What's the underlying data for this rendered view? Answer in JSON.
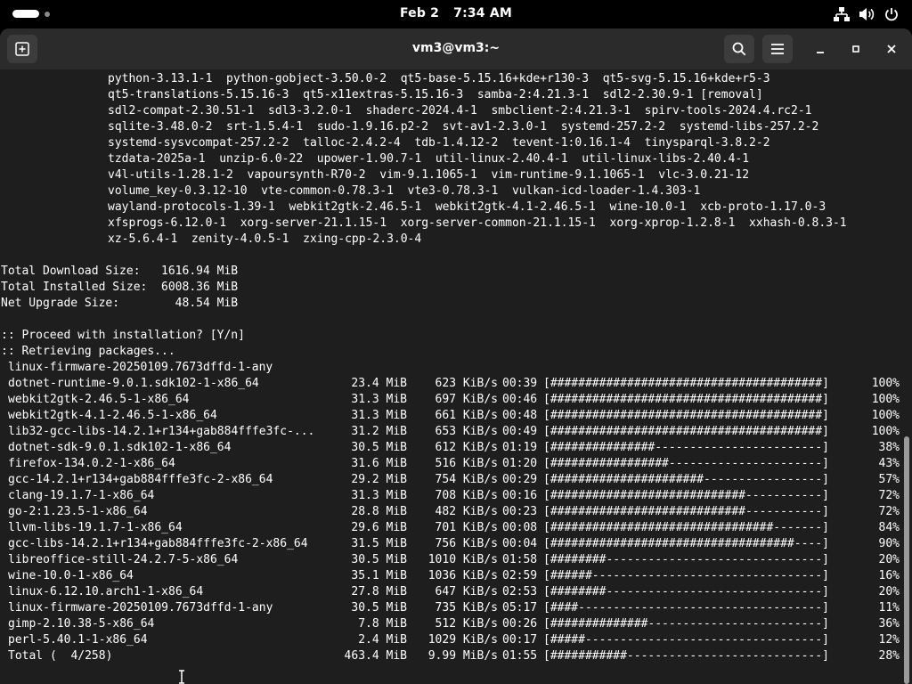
{
  "topbar": {
    "date": "Feb 2",
    "time": "7:34 AM",
    "icons": [
      "network-icon",
      "volume-icon",
      "power-icon"
    ]
  },
  "window": {
    "title": "vm3@vm3:~",
    "buttons": [
      "new-tab-icon",
      "search-icon",
      "menu-icon",
      "minimize-icon",
      "maximize-icon",
      "close-icon"
    ]
  },
  "terminal": {
    "package_lines": [
      "python-3.13.1-1  python-gobject-3.50.0-2  qt5-base-5.15.16+kde+r130-3  qt5-svg-5.15.16+kde+r5-3",
      "qt5-translations-5.15.16-3  qt5-x11extras-5.15.16-3  samba-2:4.21.3-1  sdl2-2.30.9-1 [removal]",
      "sdl2-compat-2.30.51-1  sdl3-3.2.0-1  shaderc-2024.4-1  smbclient-2:4.21.3-1  spirv-tools-2024.4.rc2-1",
      "sqlite-3.48.0-2  srt-1.5.4-1  sudo-1.9.16.p2-2  svt-av1-2.3.0-1  systemd-257.2-2  systemd-libs-257.2-2",
      "systemd-sysvcompat-257.2-2  talloc-2.4.2-4  tdb-1.4.12-2  tevent-1:0.16.1-4  tinysparql-3.8.2-2",
      "tzdata-2025a-1  unzip-6.0-22  upower-1.90.7-1  util-linux-2.40.4-1  util-linux-libs-2.40.4-1",
      "v4l-utils-1.28.1-2  vapoursynth-R70-2  vim-9.1.1065-1  vim-runtime-9.1.1065-1  vlc-3.0.21-12",
      "volume_key-0.3.12-10  vte-common-0.78.3-1  vte3-0.78.3-1  vulkan-icd-loader-1.4.303-1",
      "wayland-protocols-1.39-1  webkit2gtk-2.46.5-1  webkit2gtk-4.1-2.46.5-1  wine-10.0-1  xcb-proto-1.17.0-3",
      "xfsprogs-6.12.0-1  xorg-server-21.1.15-1  xorg-server-common-21.1.15-1  xorg-xprop-1.2.8-1  xxhash-0.8.3-1",
      "xz-5.6.4-1  zenity-4.0.5-1  zxing-cpp-2.3.0-4"
    ],
    "summary": [
      "Total Download Size:   1616.94 MiB",
      "Total Installed Size:  6008.36 MiB",
      "Net Upgrade Size:        48.54 MiB"
    ],
    "prompt": ":: Proceed with installation? [Y/n]",
    "retrieving": ":: Retrieving packages...",
    "first_pkg": " linux-firmware-20250109.7673dffd-1-any",
    "downloads": [
      {
        "name": "dotnet-runtime-9.0.1.sdk102-1-x86_64",
        "size": "23.4 MiB",
        "rate": "623 KiB/s",
        "time": "00:39",
        "bar": "[#######################################]",
        "pct": "100%"
      },
      {
        "name": "webkit2gtk-2.46.5-1-x86_64",
        "size": "31.3 MiB",
        "rate": "697 KiB/s",
        "time": "00:46",
        "bar": "[#######################################]",
        "pct": "100%"
      },
      {
        "name": "webkit2gtk-4.1-2.46.5-1-x86_64",
        "size": "31.3 MiB",
        "rate": "661 KiB/s",
        "time": "00:48",
        "bar": "[#######################################]",
        "pct": "100%"
      },
      {
        "name": "lib32-gcc-libs-14.2.1+r134+gab884fffe3fc-...",
        "size": "31.2 MiB",
        "rate": "653 KiB/s",
        "time": "00:49",
        "bar": "[#######################################]",
        "pct": "100%"
      },
      {
        "name": "dotnet-sdk-9.0.1.sdk102-1-x86_64",
        "size": "30.5 MiB",
        "rate": "612 KiB/s",
        "time": "01:19",
        "bar": "[###############------------------------]",
        "pct": "38%"
      },
      {
        "name": "firefox-134.0.2-1-x86_64",
        "size": "31.6 MiB",
        "rate": "516 KiB/s",
        "time": "01:20",
        "bar": "[#################----------------------]",
        "pct": "43%"
      },
      {
        "name": "gcc-14.2.1+r134+gab884fffe3fc-2-x86_64",
        "size": "29.2 MiB",
        "rate": "754 KiB/s",
        "time": "00:29",
        "bar": "[######################-----------------]",
        "pct": "57%"
      },
      {
        "name": "clang-19.1.7-1-x86_64",
        "size": "31.3 MiB",
        "rate": "708 KiB/s",
        "time": "00:16",
        "bar": "[############################-----------]",
        "pct": "72%"
      },
      {
        "name": "go-2:1.23.5-1-x86_64",
        "size": "28.8 MiB",
        "rate": "482 KiB/s",
        "time": "00:23",
        "bar": "[############################-----------]",
        "pct": "72%"
      },
      {
        "name": "llvm-libs-19.1.7-1-x86_64",
        "size": "29.6 MiB",
        "rate": "701 KiB/s",
        "time": "00:08",
        "bar": "[################################-------]",
        "pct": "84%"
      },
      {
        "name": "gcc-libs-14.2.1+r134+gab884fffe3fc-2-x86_64",
        "size": "31.5 MiB",
        "rate": "756 KiB/s",
        "time": "00:04",
        "bar": "[###################################----]",
        "pct": "90%"
      },
      {
        "name": "libreoffice-still-24.2.7-5-x86_64",
        "size": "30.5 MiB",
        "rate": "1010 KiB/s",
        "time": "01:58",
        "bar": "[########-------------------------------]",
        "pct": "20%"
      },
      {
        "name": "wine-10.0-1-x86_64",
        "size": "35.1 MiB",
        "rate": "1036 KiB/s",
        "time": "02:59",
        "bar": "[######---------------------------------]",
        "pct": "16%"
      },
      {
        "name": "linux-6.12.10.arch1-1-x86_64",
        "size": "27.8 MiB",
        "rate": "647 KiB/s",
        "time": "02:53",
        "bar": "[########-------------------------------]",
        "pct": "20%"
      },
      {
        "name": "linux-firmware-20250109.7673dffd-1-any",
        "size": "30.5 MiB",
        "rate": "735 KiB/s",
        "time": "05:17",
        "bar": "[####-----------------------------------]",
        "pct": "11%"
      },
      {
        "name": "gimp-2.10.38-5-x86_64",
        "size": "7.8 MiB",
        "rate": "512 KiB/s",
        "time": "00:26",
        "bar": "[##############-------------------------]",
        "pct": "36%"
      },
      {
        "name": "perl-5.40.1-1-x86_64",
        "size": "2.4 MiB",
        "rate": "1029 KiB/s",
        "time": "00:17",
        "bar": "[#####----------------------------------]",
        "pct": "12%"
      },
      {
        "name": "Total (  4/258)",
        "size": "463.4 MiB",
        "rate": "9.99 MiB/s",
        "time": "01:55",
        "bar": "[###########----------------------------]",
        "pct": "28%"
      }
    ]
  }
}
